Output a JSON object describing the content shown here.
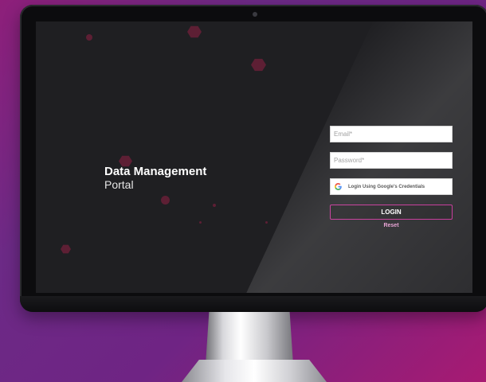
{
  "brand": {
    "title": "Data Management",
    "subtitle": "Portal",
    "logo_icon": "hexagon-bars-logo-icon"
  },
  "form": {
    "email_placeholder": "Email*",
    "password_placeholder": "Password*",
    "google_label": "Login Using Google's Credentials",
    "google_icon": "google-g-icon",
    "login_label": "LOGIN",
    "reset_label": "Reset"
  },
  "colors": {
    "background_gradient": [
      "#8e1f7a",
      "#6c2a86",
      "#a81a72"
    ],
    "screen_bg": "#1f1f22",
    "accent": "#c22a92",
    "reset_link": "#e79ad1",
    "decor_hex": "#6d1f3a"
  }
}
